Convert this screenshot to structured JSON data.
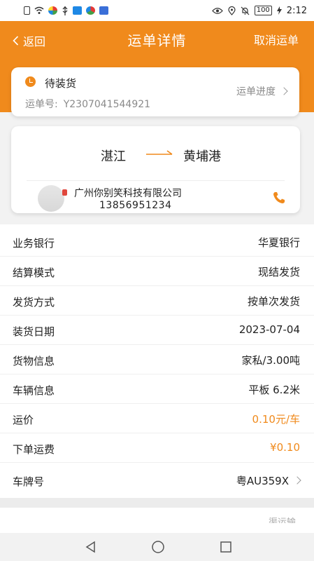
{
  "status_bar": {
    "time": "2:12",
    "battery": "100",
    "left_icons": [
      "sim-icon",
      "wifi-icon",
      "app-icon",
      "usb-icon",
      "app-icon",
      "app-icon",
      "app-icon"
    ],
    "right_icons": [
      "eye-icon",
      "location-icon",
      "mute-icon",
      "battery-icon",
      "charging-icon"
    ]
  },
  "header": {
    "back_label": "返回",
    "title": "运单详情",
    "cancel_label": "取消运单",
    "accent_color": "#f08a1c"
  },
  "status_card": {
    "status": "待装货",
    "waybill_label": "运单号:",
    "waybill_number": "Y2307041544921",
    "progress_label": "运单进度"
  },
  "route_card": {
    "from": "湛江",
    "to": "黄埔港",
    "company": "广州你别笑科技有限公司",
    "phone": "13856951234"
  },
  "details": [
    {
      "label": "业务银行",
      "value": "华夏银行",
      "highlight": false
    },
    {
      "label": "结算模式",
      "value": "现结发货",
      "highlight": false
    },
    {
      "label": "发货方式",
      "value": "按单次发货",
      "highlight": false
    },
    {
      "label": "装货日期",
      "value": "2023-07-04",
      "highlight": false
    },
    {
      "label": "货物信息",
      "value": "家私/3.00吨",
      "highlight": false
    },
    {
      "label": "车辆信息",
      "value": "平板 6.2米",
      "highlight": false
    },
    {
      "label": "运价",
      "value": "0.10元/车",
      "highlight": true
    },
    {
      "label": "下单运费",
      "value": "¥0.10",
      "highlight": true
    },
    {
      "label": "车牌号",
      "value": "粤AU359X",
      "highlight": false
    }
  ],
  "bottom_peek_text": "渠运输"
}
